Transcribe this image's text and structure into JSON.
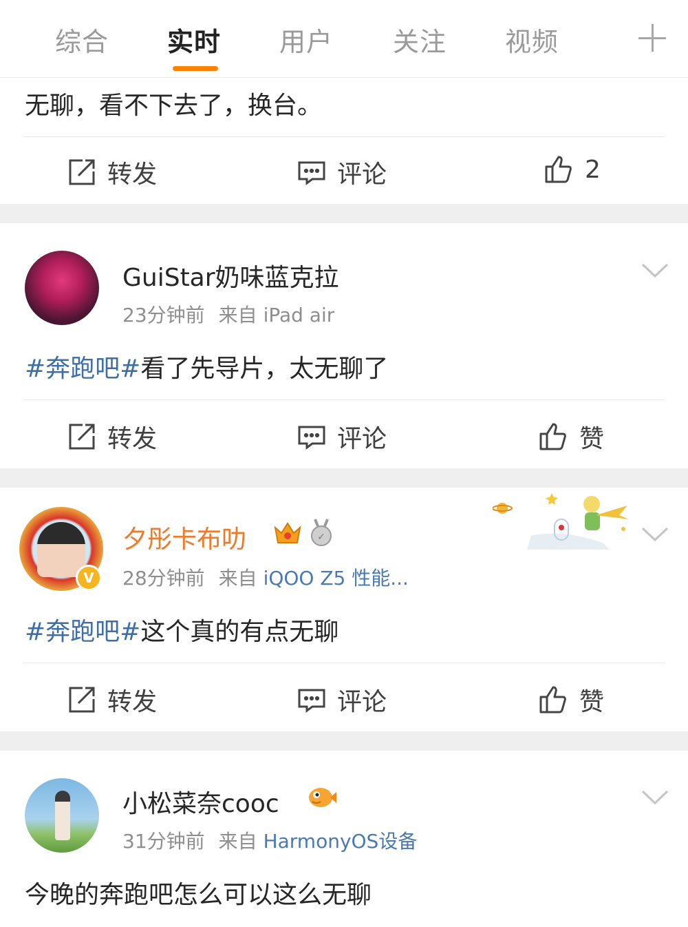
{
  "tabs": [
    {
      "label": "综合",
      "active": false
    },
    {
      "label": "实时",
      "active": true
    },
    {
      "label": "用户",
      "active": false
    },
    {
      "label": "关注",
      "active": false
    },
    {
      "label": "视频",
      "active": false
    }
  ],
  "colors": {
    "accent": "#ff8200",
    "topic": "#3c6ea8",
    "vip_name": "#f07a2a",
    "meta": "#8e8e8e"
  },
  "posts": [
    {
      "text": "无聊，看不下去了，换台。",
      "actions": {
        "repost": "转发",
        "comment": "评论",
        "like": "2"
      }
    },
    {
      "user": "GuiStar奶味蓝克拉",
      "time": "23分钟前",
      "source_prefix": "来自",
      "source": "iPad air",
      "topic": "#奔跑吧#",
      "text": "看了先导片，太无聊了",
      "actions": {
        "repost": "转发",
        "comment": "评论",
        "like": "赞"
      }
    },
    {
      "user": "夕彤卡布叻",
      "time": "28分钟前",
      "source_prefix": "来自",
      "source": "iQOO Z5 性能...",
      "topic": "#奔跑吧#",
      "text": "这个真的有点无聊",
      "badges": [
        "crown-icon",
        "medal-icon",
        "verified-icon"
      ],
      "actions": {
        "repost": "转发",
        "comment": "评论",
        "like": "赞"
      }
    },
    {
      "user": "小松菜奈cooc",
      "time": "31分钟前",
      "source_prefix": "来自",
      "source": "HarmonyOS设备",
      "text": "今晚的奔跑吧怎么可以这么无聊"
    }
  ]
}
